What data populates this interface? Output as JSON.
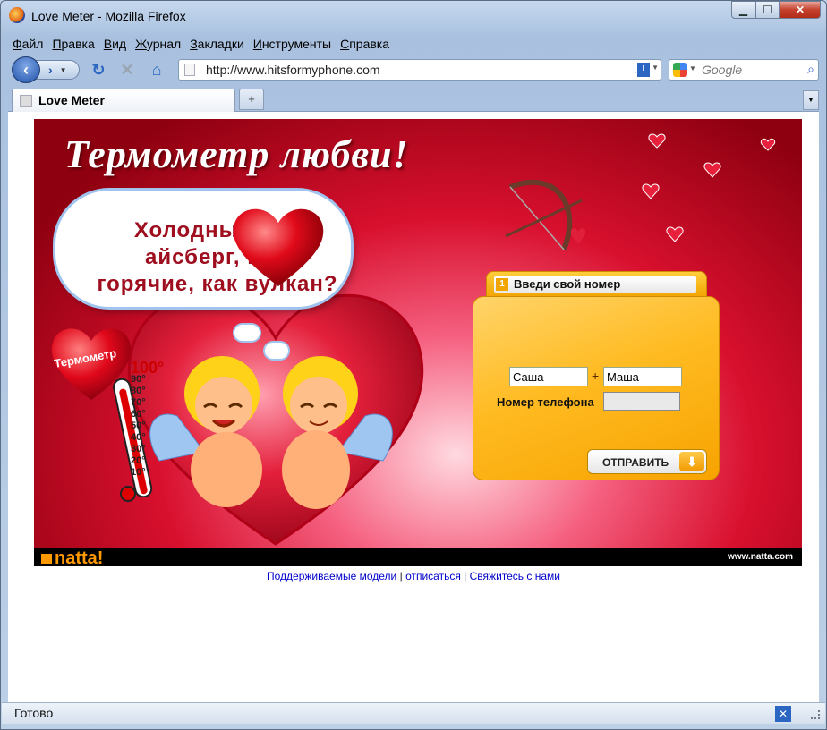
{
  "window": {
    "title": "Love Meter - Mozilla Firefox"
  },
  "menubar": {
    "items": [
      {
        "hotkey": "Ф",
        "rest": "айл"
      },
      {
        "hotkey": "П",
        "rest": "равка"
      },
      {
        "hotkey": "В",
        "rest": "ид"
      },
      {
        "hotkey": "Ж",
        "rest": "урнал"
      },
      {
        "hotkey": "З",
        "rest": "акладки"
      },
      {
        "hotkey": "И",
        "rest": "нструменты"
      },
      {
        "hotkey": "С",
        "rest": "правка"
      }
    ]
  },
  "navbar": {
    "url": "http://www.hitsformyphone.com",
    "search_placeholder": "Google"
  },
  "tab": {
    "label": "Love Meter",
    "new_tab": "+"
  },
  "banner": {
    "title": "Термометр любви!",
    "cloud_line1": "Холодные, как",
    "cloud_line2": "айсберг, или",
    "cloud_line3": "горячие, как вулкан?",
    "thermometer_label": "Термометр",
    "scale": [
      "100°",
      "90°",
      "80°",
      "70°",
      "60°",
      "50°",
      "40°",
      "30°",
      "20°",
      "10°"
    ],
    "form": {
      "step": "1",
      "step_label": "Введи свой номер",
      "name1_value": "Саша",
      "name2_value": "Маша",
      "plus": "+",
      "phone_label": "Номер телефона",
      "phone_value": "",
      "submit_label": "ОТПРАВИТЬ"
    },
    "brand": "natta!",
    "brand_url": "www.natta.com"
  },
  "footer_links": {
    "supported_models": "Поддерживаемые модели",
    "unsubscribe": "отписаться",
    "contact": "Свяжитесь с нами",
    "separator": "|"
  },
  "statusbar": {
    "text": "Готово"
  },
  "colors": {
    "banner_red": "#d8102e",
    "form_orange": "#ffbb22",
    "link_blue": "#0000cc"
  }
}
